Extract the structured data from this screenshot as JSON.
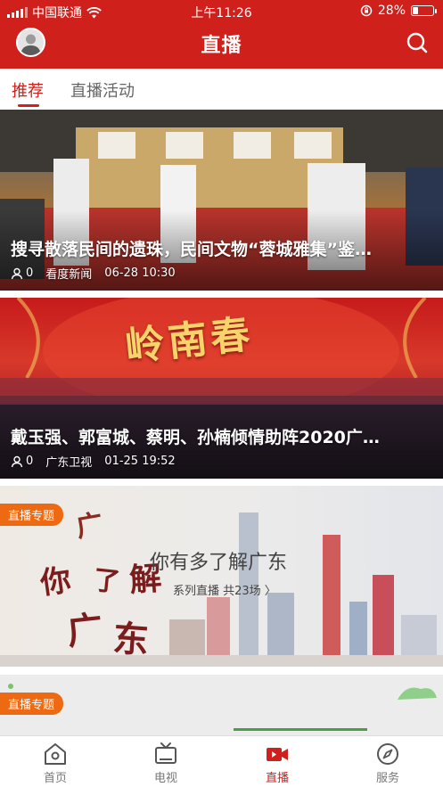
{
  "status_bar": {
    "carrier": "中国联通",
    "time": "上午11:26",
    "battery_text": "28%",
    "battery_level": 0.28
  },
  "header": {
    "title": "直播"
  },
  "tabs": [
    {
      "label": "推荐",
      "active": true
    },
    {
      "label": "直播活动",
      "active": false
    }
  ],
  "feed": [
    {
      "title": "搜寻散落民间的遗珠，民间文物“蓉城雅集”鉴…",
      "viewers": "0",
      "source": "看度新闻",
      "time": "06-28 10:30"
    },
    {
      "title": "戴玉强、郭富城、蔡明、孙楠倾情助阵2020广…",
      "viewers": "0",
      "source": "广东卫视",
      "time": "01-25 19:52"
    }
  ],
  "topics": [
    {
      "badge": "直播专题",
      "title": "你有多了解广东",
      "subtitle": "系列直播 共23场 〉"
    },
    {
      "badge": "直播专题"
    }
  ],
  "bottom_nav": [
    {
      "label": "首页",
      "icon": "home-icon",
      "active": false
    },
    {
      "label": "电视",
      "icon": "tv-icon",
      "active": false
    },
    {
      "label": "直播",
      "icon": "live-camera-icon",
      "active": true
    },
    {
      "label": "服务",
      "icon": "compass-icon",
      "active": false
    }
  ],
  "colors": {
    "brand_red": "#d0201b",
    "badge_orange": "#ee6a12"
  }
}
